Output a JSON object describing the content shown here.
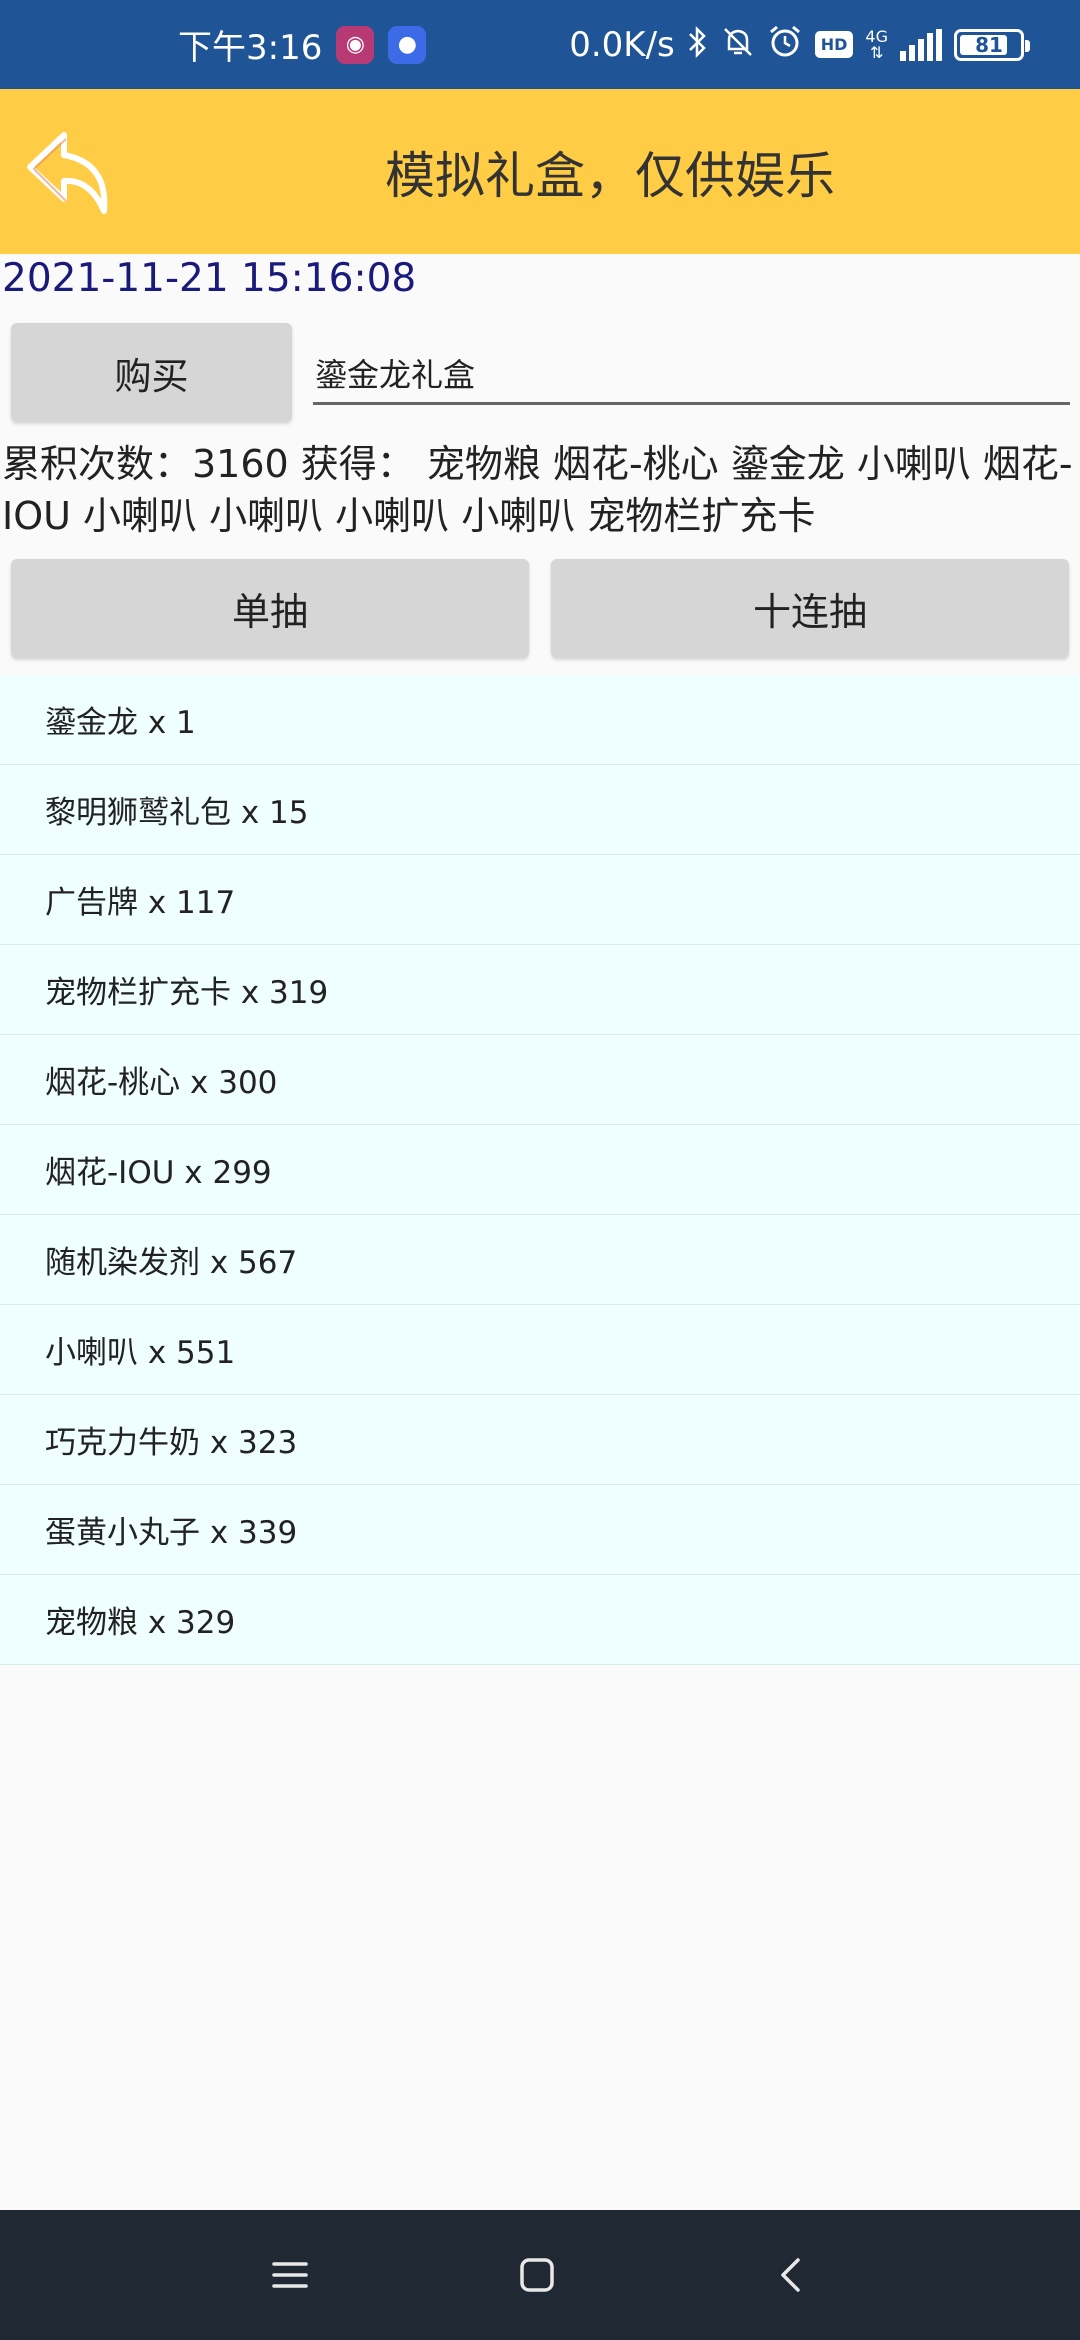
{
  "status_bar": {
    "time": "下午3:16",
    "net_speed": "0.0K/s",
    "hd": "HD",
    "network_type": "4G",
    "battery": "81",
    "battery_level": 0.81,
    "icons": [
      "app-icon-1",
      "app-icon-2",
      "bluetooth-icon",
      "mute-icon",
      "alarm-icon",
      "hd-icon",
      "signal-icon",
      "battery-icon"
    ]
  },
  "header": {
    "title": "模拟礼盒，仅供娱乐",
    "back_icon": "back-arrow-icon",
    "background": "#ffcd45"
  },
  "timestamp": "2021-11-21 15:16:08",
  "buy": {
    "button_label": "购买",
    "input_value": "鎏金龙礼盒"
  },
  "summary": {
    "text": "累积次数：3160 获得： 宠物粮 烟花-桃心 鎏金龙 小喇叭 烟花-IOU 小喇叭 小喇叭 小喇叭 小喇叭 宠物栏扩充卡"
  },
  "draw_buttons": {
    "single": "单抽",
    "ten": "十连抽"
  },
  "items": [
    {
      "text": "鎏金龙 x 1"
    },
    {
      "text": "黎明狮鹫礼包 x 15"
    },
    {
      "text": "广告牌 x 117"
    },
    {
      "text": "宠物栏扩充卡 x 319"
    },
    {
      "text": "烟花-桃心 x 300"
    },
    {
      "text": "烟花-IOU x 299"
    },
    {
      "text": "随机染发剂 x 567"
    },
    {
      "text": "小喇叭 x 551"
    },
    {
      "text": "巧克力牛奶 x 323"
    },
    {
      "text": "蛋黄小丸子 x 339"
    },
    {
      "text": "宠物粮 x 329"
    }
  ],
  "nav": {
    "icons": [
      "menu-icon",
      "home-icon",
      "back-icon"
    ]
  },
  "colors": {
    "status_bar": "#1f5596",
    "header": "#ffcd45",
    "list_bg": "#effeff",
    "button_bg": "#d6d6d6",
    "nav_bar": "#1f2833"
  }
}
